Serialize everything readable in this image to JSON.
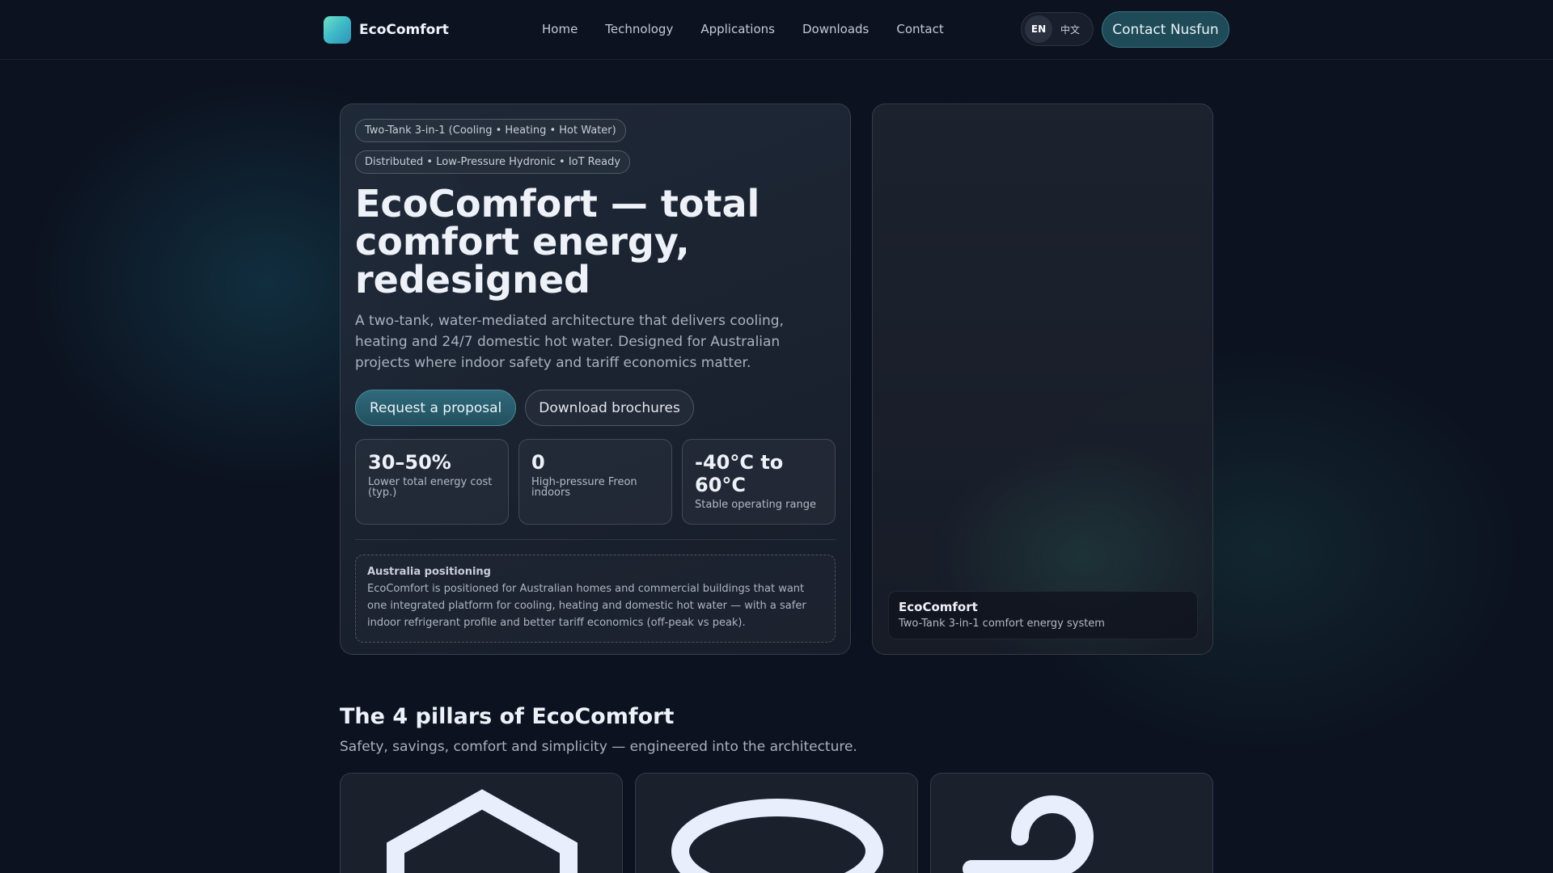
{
  "header": {
    "brand": "EcoComfort",
    "nav": [
      "Home",
      "Technology",
      "Applications",
      "Downloads",
      "Contact"
    ],
    "lang_en": "EN",
    "lang_zh": "中文",
    "contact_button": "Contact Nusfun"
  },
  "hero": {
    "tags": [
      "Two-Tank 3-in-1 (Cooling • Heating • Hot Water)",
      "Distributed • Low-Pressure Hydronic • IoT Ready"
    ],
    "title": "EcoComfort — total comfort energy, redesigned",
    "subtitle": "A two-tank, water-mediated architecture that delivers cooling, heating and 24/7 domestic hot water. Designed for Australian projects where indoor safety and tariff economics matter.",
    "primary_button": "Request a proposal",
    "secondary_button": "Download brochures",
    "stats": [
      {
        "value": "30–50%",
        "label": "Lower total energy cost (typ.)"
      },
      {
        "value": "0",
        "label": "High-pressure Freon indoors"
      },
      {
        "value": "-40°C to 60°C",
        "label": "Stable operating range"
      }
    ],
    "note": {
      "title": "Australia positioning",
      "body": "EcoComfort is positioned for Australian homes and commercial buildings that want one integrated platform for cooling, heating and domestic hot water — with a safer indoor refrigerant profile and better tariff economics (off-peak vs peak)."
    }
  },
  "media": {
    "caption_title": "EcoComfort",
    "caption_subtitle": "Two-Tank 3-in-1 comfort energy system"
  },
  "pillars": {
    "title": "The 4 pillars of EcoComfort",
    "subtitle": "Safety, savings, comfort and simplicity — engineered into the architecture.",
    "icons": [
      "shield-icon",
      "coin-icon",
      "wind-icon"
    ]
  },
  "colors": {
    "background": "#0c1220",
    "accent": "#2f6a7b",
    "logo_gradient": [
      "#6ee2c2",
      "#2f93b3"
    ]
  }
}
